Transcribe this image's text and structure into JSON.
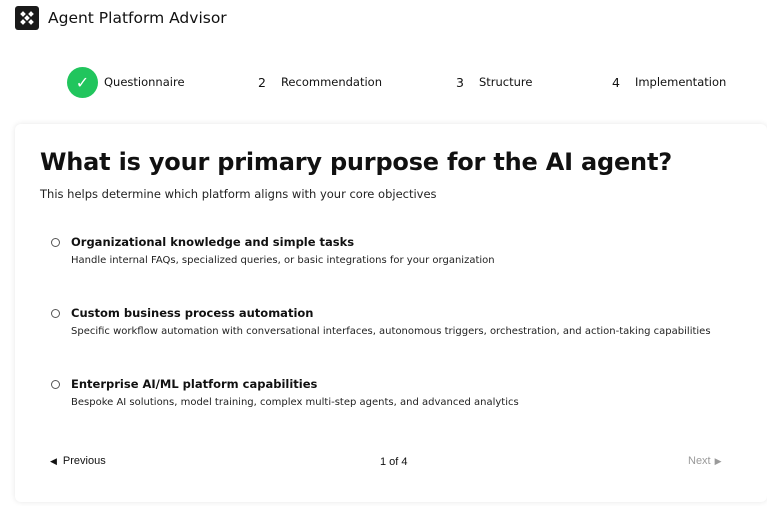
{
  "app": {
    "title": "Agent Platform Advisor",
    "logo_icon": "puzzle-logo-icon"
  },
  "stepper": {
    "steps": [
      {
        "number": "",
        "label": "Questionnaire",
        "status": "complete"
      },
      {
        "number": "2",
        "label": "Recommendation",
        "status": "pending"
      },
      {
        "number": "3",
        "label": "Structure",
        "status": "pending"
      },
      {
        "number": "4",
        "label": "Implementation",
        "status": "pending"
      }
    ],
    "check_glyph": "✓",
    "complete_color": "#21c55d"
  },
  "question": {
    "title": "What is your primary purpose for the AI agent?",
    "subtitle": "This helps determine which platform aligns with your core objectives",
    "options": [
      {
        "title": "Organizational knowledge and simple tasks",
        "description": "Handle internal FAQs, specialized queries, or basic integrations for your organization",
        "selected": false
      },
      {
        "title": "Custom business process automation",
        "description": "Specific workflow automation with conversational interfaces, autonomous triggers, orchestration, and action-taking capabilities",
        "selected": false
      },
      {
        "title": "Enterprise AI/ML platform capabilities",
        "description": "Bespoke AI solutions, model training, complex multi-step agents, and advanced analytics",
        "selected": false
      }
    ]
  },
  "navigation": {
    "previous_label": "Previous",
    "previous_arrow": "◀",
    "page_indicator": "1 of 4",
    "next_label": "Next",
    "next_arrow": "▶",
    "next_disabled": true
  }
}
